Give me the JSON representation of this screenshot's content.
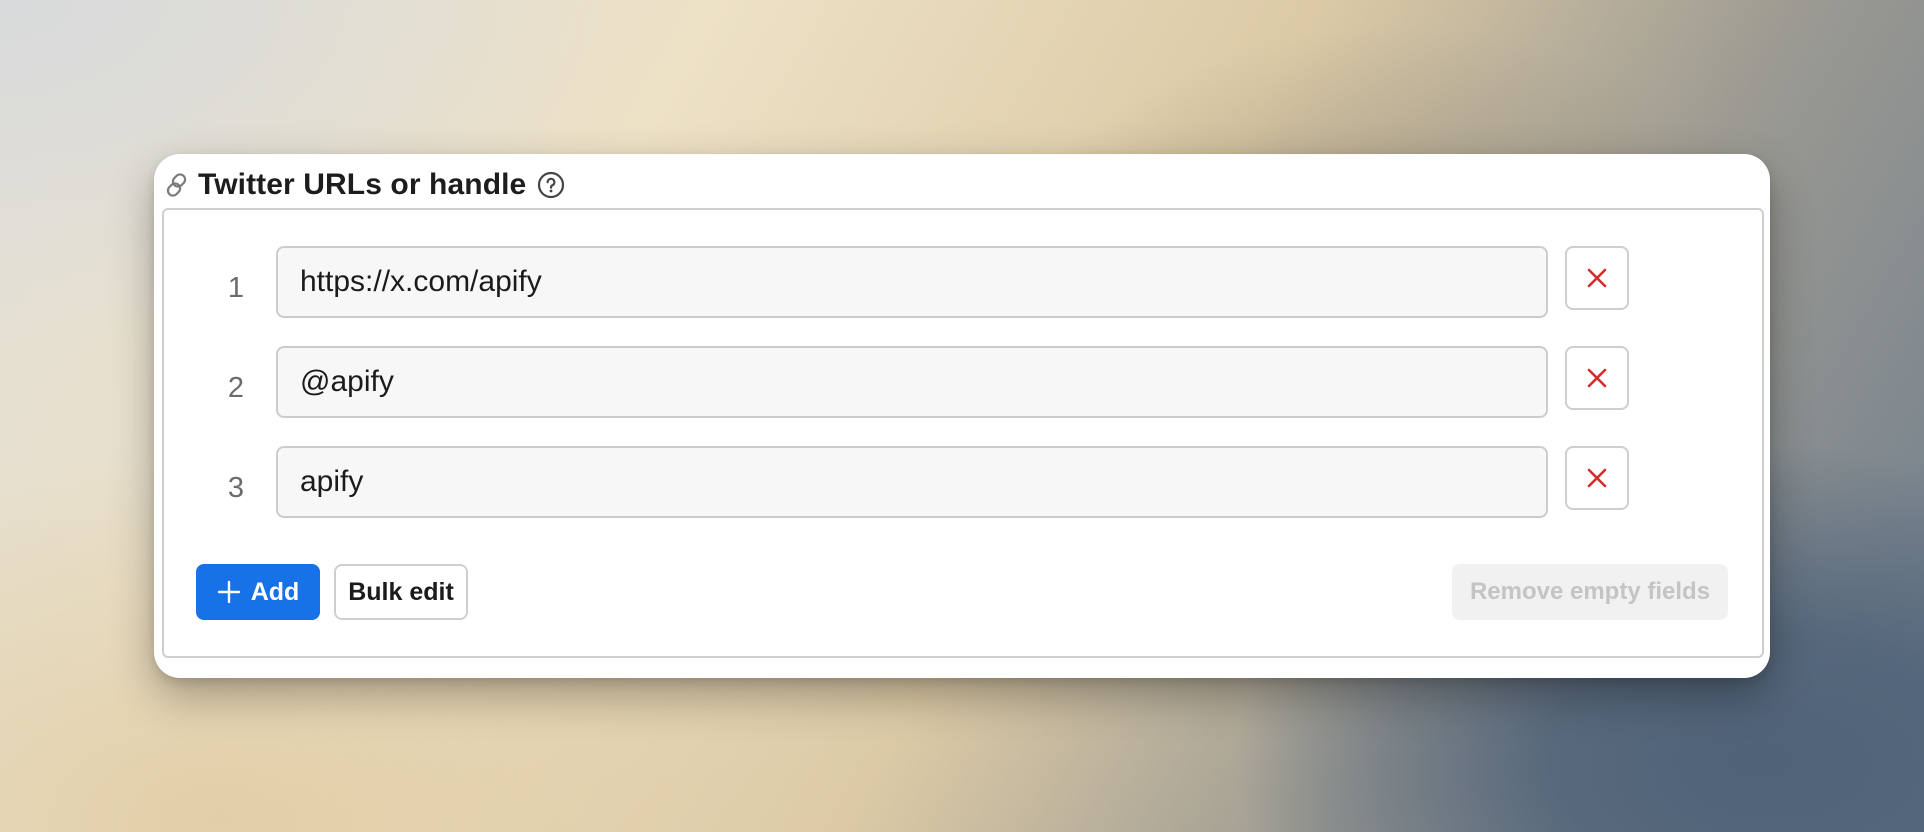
{
  "field": {
    "title": "Twitter URLs or handle",
    "title_icon": "link-icon",
    "help_icon": "help-circle-icon"
  },
  "rows": [
    {
      "number": "1",
      "value": "https://x.com/apify"
    },
    {
      "number": "2",
      "value": "@apify"
    },
    {
      "number": "3",
      "value": "apify"
    }
  ],
  "actions": {
    "add_label": "Add",
    "add_icon": "plus-icon",
    "bulk_edit_label": "Bulk edit",
    "remove_empty_label": "Remove empty fields",
    "remove_row_icon": "close-icon"
  },
  "colors": {
    "accent": "#1672e6",
    "remove_x": "#d62c2c",
    "disabled_text": "#c4c4c6"
  }
}
